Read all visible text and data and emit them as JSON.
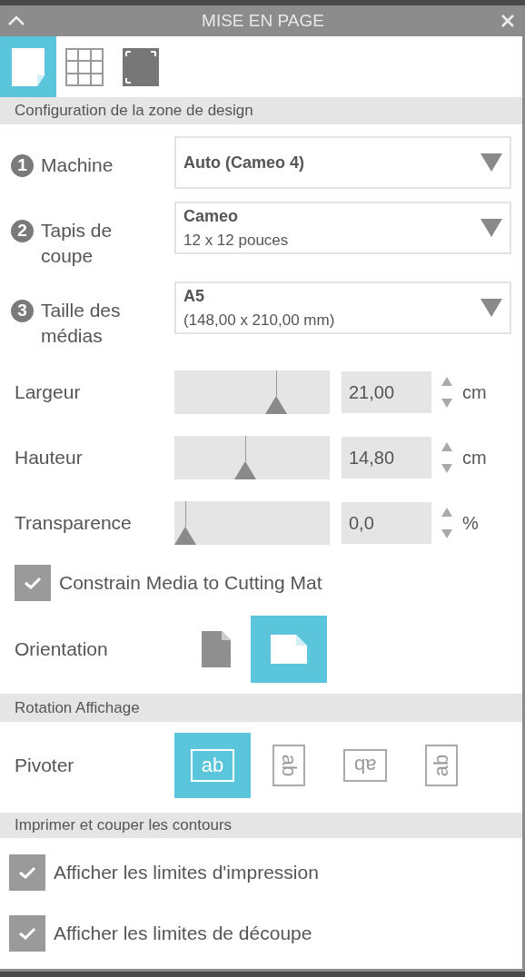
{
  "window": {
    "title": "MISE EN PAGE"
  },
  "tabs": [
    {
      "kind": "page",
      "selected": true
    },
    {
      "kind": "grid",
      "selected": false
    },
    {
      "kind": "frame",
      "selected": false
    }
  ],
  "design_section": {
    "title": "Configuration de la zone de design",
    "steps": [
      {
        "number": "1",
        "label": "Machine",
        "value": "Auto (Cameo 4)"
      },
      {
        "number": "2",
        "label": "Tapis de coupe",
        "value": "Cameo",
        "detail": "12 x 12 pouces"
      },
      {
        "number": "3",
        "label": "Taille des médias",
        "value": "A5",
        "detail": "(148,00 x 210,00 mm)"
      }
    ],
    "sliders": [
      {
        "label": "Largeur",
        "level": 0.68,
        "value": "21,00",
        "unit": "cm"
      },
      {
        "label": "Hauteur",
        "level": 0.45,
        "value": "14,80",
        "unit": "cm"
      },
      {
        "label": "Transparence",
        "level": 0,
        "value": "0,0",
        "unit": "%"
      }
    ],
    "constrain": {
      "label": "Constrain Media to Cutting Mat",
      "checked": true
    },
    "orientation": {
      "label": "Orientation",
      "options": [
        {
          "kind": "portrait",
          "selected": false
        },
        {
          "kind": "landscape",
          "selected": true
        }
      ]
    }
  },
  "rotation_section": {
    "title": "Rotation Affichage",
    "label": "Pivoter",
    "options": [
      {
        "kind": "r0",
        "text": "ab",
        "selected": true
      },
      {
        "kind": "r90",
        "text": "ab",
        "selected": false
      },
      {
        "kind": "r180",
        "text": "ab",
        "selected": false
      },
      {
        "kind": "r270",
        "text": "ab",
        "selected": false
      }
    ]
  },
  "print_section": {
    "title": "Imprimer et couper les contours",
    "checkboxes": [
      {
        "label": "Afficher les limites d'impression",
        "checked": true
      },
      {
        "label": "Afficher les limites de découpe",
        "checked": true
      }
    ]
  }
}
